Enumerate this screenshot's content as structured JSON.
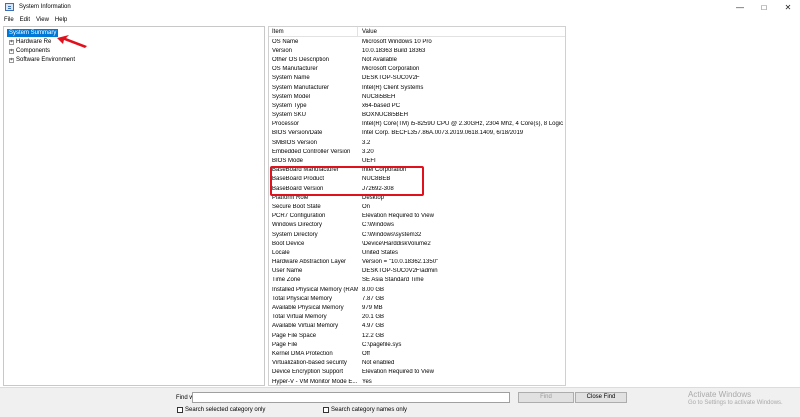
{
  "window": {
    "title": "System Information",
    "minimize_glyph": "—",
    "maximize_glyph": "□",
    "close_glyph": "✕"
  },
  "menu": [
    "File",
    "Edit",
    "View",
    "Help"
  ],
  "tree": {
    "root": "System Summary",
    "children": [
      {
        "label": "Hardware Re",
        "toggle": "+"
      },
      {
        "label": "Components",
        "toggle": "+"
      },
      {
        "label": "Software Environment",
        "toggle": "+"
      }
    ]
  },
  "table": {
    "headers": [
      "Item",
      "Value"
    ],
    "rows": [
      [
        "OS Name",
        "Microsoft Windows 10 Pro"
      ],
      [
        "Version",
        "10.0.18363 Build 18363"
      ],
      [
        "Other OS Description",
        "Not Available"
      ],
      [
        "OS Manufacturer",
        "Microsoft Corporation"
      ],
      [
        "System Name",
        "DESKTOP-SUC0V2F"
      ],
      [
        "System Manufacturer",
        "Intel(R) Client Systems"
      ],
      [
        "System Model",
        "NUC8i5BEH"
      ],
      [
        "System Type",
        "x64-based PC"
      ],
      [
        "System SKU",
        "BOXNUC8i5BEH"
      ],
      [
        "Processor",
        "Intel(R) Core(TM) i5-8259U CPU @ 2.30GHz, 2304 Mhz, 4 Core(s), 8 Logical Pr..."
      ],
      [
        "BIOS Version/Date",
        "Intel Corp. BECFL357.86A.0073.2019.0618.1409, 6/18/2019"
      ],
      [
        "SMBIOS Version",
        "3.2"
      ],
      [
        "Embedded Controller Version",
        "3.20"
      ],
      [
        "BIOS Mode",
        "UEFI"
      ],
      [
        "BaseBoard Manufacturer",
        "Intel Corporation"
      ],
      [
        "BaseBoard Product",
        "NUC8BEB"
      ],
      [
        "BaseBoard Version",
        "J72692-308"
      ],
      [
        "Platform Role",
        "Desktop"
      ],
      [
        "Secure Boot State",
        "On"
      ],
      [
        "PCR7 Configuration",
        "Elevation Required to View"
      ],
      [
        "Windows Directory",
        "C:\\Windows"
      ],
      [
        "System Directory",
        "C:\\Windows\\system32"
      ],
      [
        "Boot Device",
        "\\Device\\HarddiskVolume2"
      ],
      [
        "Locale",
        "United States"
      ],
      [
        "Hardware Abstraction Layer",
        "Version = \"10.0.18362.1350\""
      ],
      [
        "User Name",
        "DESKTOP-SUC0V2F\\admin"
      ],
      [
        "Time Zone",
        "SE Asia Standard Time"
      ],
      [
        "Installed Physical Memory (RAM)",
        "8.00 GB"
      ],
      [
        "Total Physical Memory",
        "7.87 GB"
      ],
      [
        "Available Physical Memory",
        "979 MB"
      ],
      [
        "Total Virtual Memory",
        "20.1 GB"
      ],
      [
        "Available Virtual Memory",
        "4.97 GB"
      ],
      [
        "Page File Space",
        "12.2 GB"
      ],
      [
        "Page File",
        "C:\\pagefile.sys"
      ],
      [
        "Kernel DMA Protection",
        "Off"
      ],
      [
        "Virtualization-based security",
        "Not enabled"
      ],
      [
        "Device Encryption Support",
        "Elevation Required to View"
      ],
      [
        "Hyper-V - VM Monitor Mode E...",
        "Yes"
      ]
    ]
  },
  "find": {
    "label": "Find what:",
    "value": "",
    "find_button": "Find",
    "close_button": "Close Find",
    "check_selected": "Search selected category only",
    "check_names": "Search category names only"
  },
  "watermark": {
    "title": "Activate Windows",
    "subtitle": "Go to Settings to activate Windows."
  },
  "colors": {
    "selection": "#0078d7",
    "highlight_box": "#e0101c",
    "arrow": "#e0101c"
  }
}
